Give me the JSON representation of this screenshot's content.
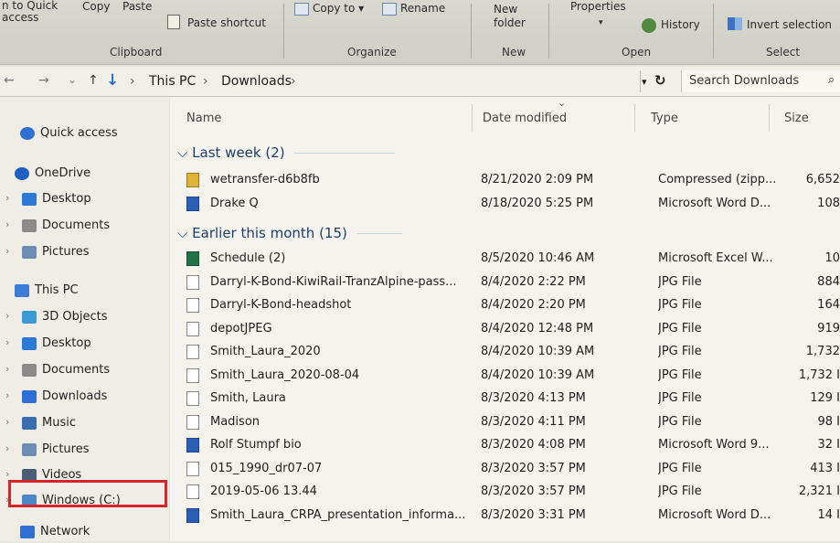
{
  "ribbon": {
    "pin_line1": "n to Quick",
    "pin_line2": "access",
    "copy": "Copy",
    "paste": "Paste",
    "paste_shortcut": "Paste shortcut",
    "copy_to": "Copy to ▾",
    "rename": "Rename",
    "new_folder_1": "New",
    "new_folder_2": "folder",
    "properties": "Properties",
    "history": "History",
    "invert_selection": "Invert selection",
    "groups": {
      "clipboard": "Clipboard",
      "organize": "Organize",
      "new": "New",
      "open": "Open",
      "select": "Select"
    }
  },
  "address": {
    "back": "←",
    "forward": "→",
    "recent": "⌄",
    "up": "↑",
    "crumbs": [
      "This PC",
      "Downloads"
    ],
    "search_placeholder": "Search Downloads"
  },
  "nav_pane": {
    "items": [
      {
        "label": "Quick access",
        "icon": "star-icon",
        "color": "#2f6fd1"
      },
      {
        "label": "OneDrive",
        "icon": "cloud-icon",
        "color": "#1f5fbf"
      },
      {
        "label": "Desktop",
        "icon": "desktop-icon",
        "color": "#2b7ad8"
      },
      {
        "label": "Documents",
        "icon": "documents-icon",
        "color": "#8a8a8a"
      },
      {
        "label": "Pictures",
        "icon": "pictures-icon",
        "color": "#6d8db5"
      },
      {
        "label": "This PC",
        "icon": "computer-icon",
        "color": "#3a7bd5"
      },
      {
        "label": "3D Objects",
        "icon": "cube-icon",
        "color": "#3a9bd5"
      },
      {
        "label": "Desktop",
        "icon": "desktop-icon",
        "color": "#2b7ad8"
      },
      {
        "label": "Documents",
        "icon": "documents-icon",
        "color": "#8a8a8a"
      },
      {
        "label": "Downloads",
        "icon": "download-arrow-icon",
        "color": "#2a6fd6"
      },
      {
        "label": "Music",
        "icon": "music-icon",
        "color": "#3a6fb0"
      },
      {
        "label": "Pictures",
        "icon": "pictures-icon",
        "color": "#6d8db5"
      },
      {
        "label": "Videos",
        "icon": "videos-icon",
        "color": "#4a5e78"
      },
      {
        "label": "Windows (C:)",
        "icon": "drive-icon",
        "color": "#4f86c6"
      },
      {
        "label": "Network",
        "icon": "network-icon",
        "color": "#2f6fd1"
      }
    ],
    "highlight_color": "#d8232a"
  },
  "columns": {
    "name": "Name",
    "date": "Date modified",
    "type": "Type",
    "size": "Size"
  },
  "groups": [
    {
      "label": "Last week (2)",
      "files": [
        {
          "name": "wetransfer-d6b8fb",
          "date": "8/21/2020 2:09 PM",
          "type": "Compressed (zipp...",
          "size": "6,652",
          "kind": "zip"
        },
        {
          "name": "Drake Q",
          "date": "8/18/2020 5:25 PM",
          "type": "Microsoft Word D...",
          "size": "108",
          "kind": "word"
        }
      ]
    },
    {
      "label": "Earlier this month (15)",
      "files": [
        {
          "name": "Schedule (2)",
          "date": "8/5/2020 10:46 AM",
          "type": "Microsoft Excel W...",
          "size": "10",
          "kind": "excel"
        },
        {
          "name": "Darryl-K-Bond-KiwiRail-TranzAlpine-pass...",
          "date": "8/4/2020 2:22 PM",
          "type": "JPG File",
          "size": "884",
          "kind": "jpg"
        },
        {
          "name": "Darryl-K-Bond-headshot",
          "date": "8/4/2020 2:20 PM",
          "type": "JPG File",
          "size": "164",
          "kind": "jpg"
        },
        {
          "name": "depotJPEG",
          "date": "8/4/2020 12:48 PM",
          "type": "JPG File",
          "size": "919",
          "kind": "jpg"
        },
        {
          "name": "Smith_Laura_2020",
          "date": "8/4/2020 10:39 AM",
          "type": "JPG File",
          "size": "1,732",
          "kind": "jpg"
        },
        {
          "name": "Smith_Laura_2020-08-04",
          "date": "8/4/2020 10:39 AM",
          "type": "JPG File",
          "size": "1,732 I",
          "kind": "jpg"
        },
        {
          "name": "Smith, Laura",
          "date": "8/3/2020 4:13 PM",
          "type": "JPG File",
          "size": "129 I",
          "kind": "jpg"
        },
        {
          "name": "Madison",
          "date": "8/3/2020 4:11 PM",
          "type": "JPG File",
          "size": "98 I",
          "kind": "jpg"
        },
        {
          "name": "Rolf Stumpf bio",
          "date": "8/3/2020 4:08 PM",
          "type": "Microsoft Word 9...",
          "size": "32 I",
          "kind": "word"
        },
        {
          "name": "015_1990_dr07-07",
          "date": "8/3/2020 3:57 PM",
          "type": "JPG File",
          "size": "413 I",
          "kind": "jpg"
        },
        {
          "name": "2019-05-06 13.44",
          "date": "8/3/2020 3:57 PM",
          "type": "JPG File",
          "size": "2,321 I",
          "kind": "jpg"
        },
        {
          "name": "Smith_Laura_CRPA_presentation_informa...",
          "date": "8/3/2020 3:31 PM",
          "type": "Microsoft Word D...",
          "size": "14 I",
          "kind": "word"
        }
      ]
    }
  ]
}
